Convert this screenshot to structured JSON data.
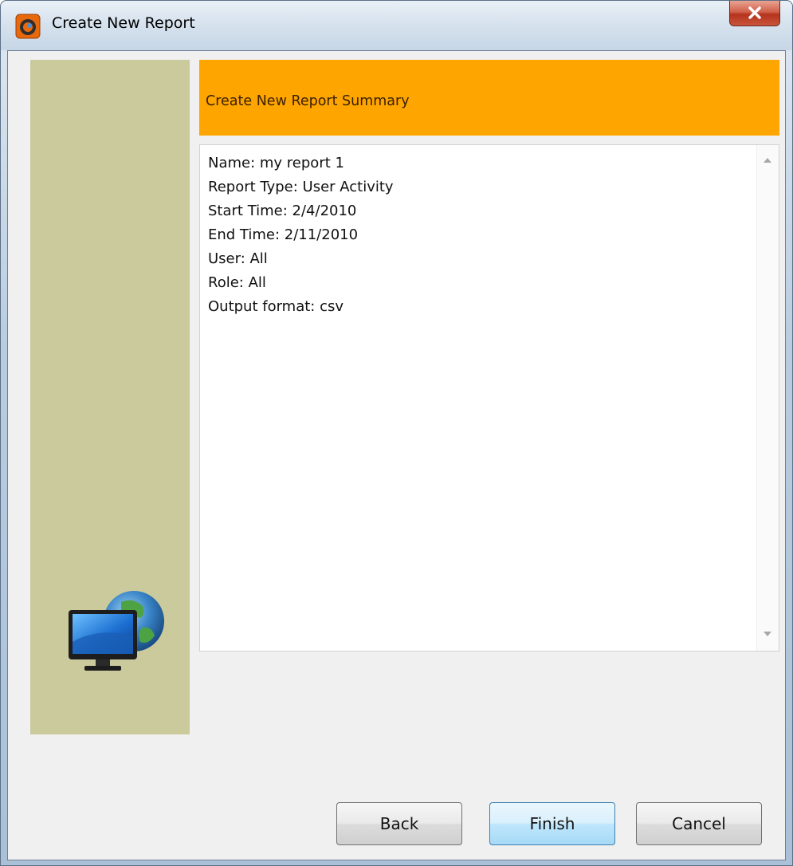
{
  "window": {
    "title": "Create New Report",
    "close_label": "x"
  },
  "header": {
    "title": "Create New Report Summary",
    "accent_color": "#ffa500"
  },
  "side_panel": {
    "color": "#cbca9c",
    "graphic_icon": "computer-globe-icon"
  },
  "summary": {
    "lines": [
      "Name: my report 1",
      "Report Type: User Activity",
      "Start Time: 2/4/2010",
      "End Time: 2/11/2010",
      "User: All",
      "Role: All",
      "Output format: csv"
    ]
  },
  "buttons": {
    "back": "Back",
    "finish": "Finish",
    "cancel": "Cancel"
  }
}
